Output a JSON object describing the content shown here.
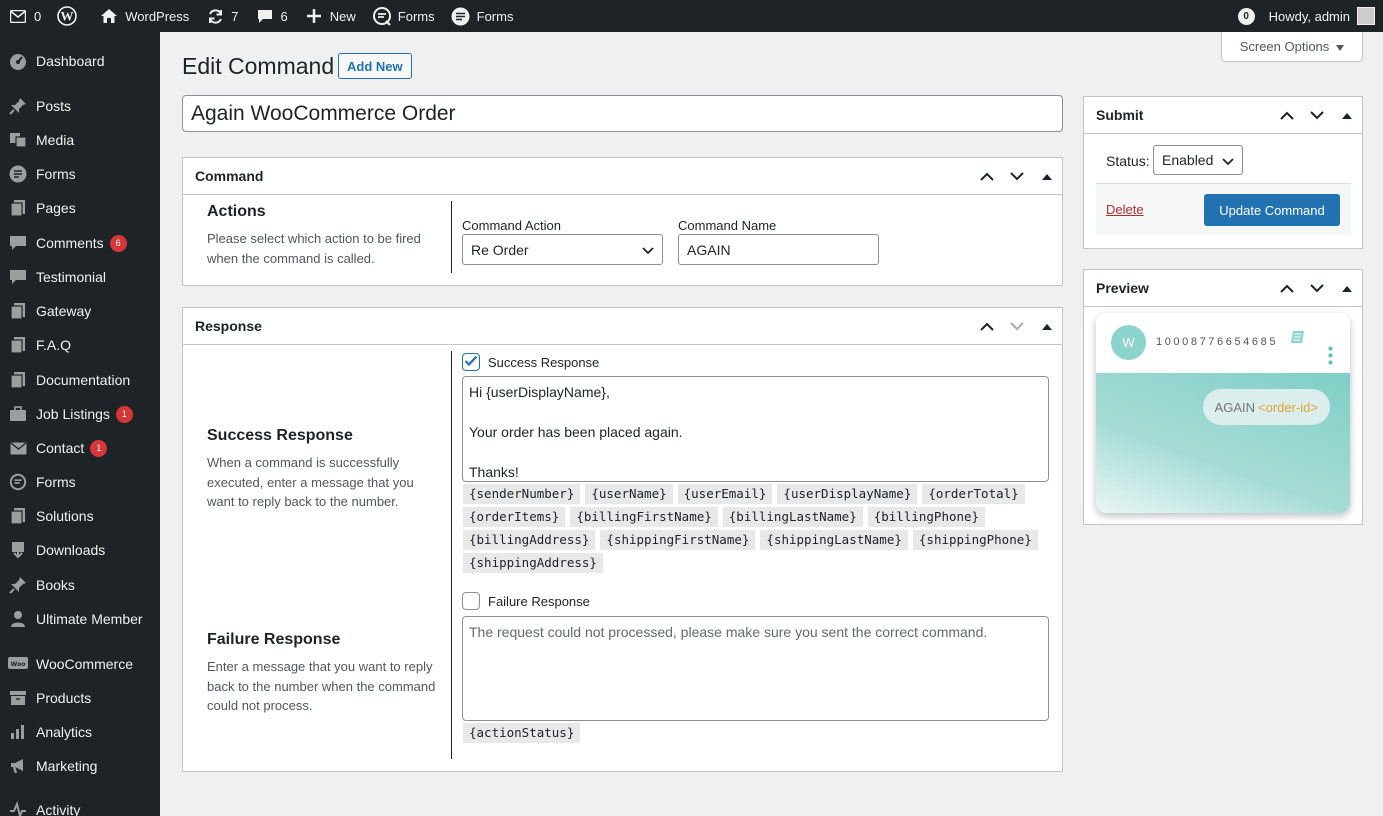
{
  "adminbar": {
    "updates_label": "0",
    "site_name": "WordPress",
    "refresh_count": "7",
    "comments_count": "6",
    "new_label": "New",
    "forms1_label": "Forms",
    "forms2_label": "Forms",
    "notifications": "0",
    "howdy": "Howdy, admin"
  },
  "sidebar": {
    "items": [
      {
        "label": "Dashboard",
        "icon": "dashboard-icon"
      },
      {
        "label": "Posts",
        "icon": "pin-icon"
      },
      {
        "label": "Media",
        "icon": "media-icon"
      },
      {
        "label": "Forms",
        "icon": "forms-icon"
      },
      {
        "label": "Pages",
        "icon": "page-icon"
      },
      {
        "label": "Comments",
        "icon": "comment-icon",
        "badge": "6"
      },
      {
        "label": "Testimonial",
        "icon": "comment-icon"
      },
      {
        "label": "Gateway",
        "icon": "page-icon"
      },
      {
        "label": "F.A.Q",
        "icon": "page-icon"
      },
      {
        "label": "Documentation",
        "icon": "page-icon"
      },
      {
        "label": "Job Listings",
        "icon": "briefcase-icon",
        "badge": "1"
      },
      {
        "label": "Contact",
        "icon": "mail-icon",
        "badge": "1"
      },
      {
        "label": "Forms",
        "icon": "forms-icon"
      },
      {
        "label": "Solutions",
        "icon": "page-icon"
      },
      {
        "label": "Downloads",
        "icon": "download-icon"
      },
      {
        "label": "Books",
        "icon": "pin-icon"
      },
      {
        "label": "Ultimate Member",
        "icon": "user-icon"
      },
      {
        "label": "WooCommerce",
        "icon": "woo-icon"
      },
      {
        "label": "Products",
        "icon": "archive-icon"
      },
      {
        "label": "Analytics",
        "icon": "chart-icon"
      },
      {
        "label": "Marketing",
        "icon": "megaphone-icon"
      },
      {
        "label": "Activity",
        "icon": "activity-icon"
      }
    ]
  },
  "screen_options": "Screen Options",
  "page": {
    "title": "Edit Command",
    "add_new": "Add New",
    "post_title": "Again WooCommerce Order"
  },
  "command_box": {
    "title": "Command",
    "actions_heading": "Actions",
    "actions_desc": "Please select which action to be fired when the command is called.",
    "action_label": "Command Action",
    "action_value": "Re Order",
    "name_label": "Command Name",
    "name_value": "AGAIN"
  },
  "response_box": {
    "title": "Response",
    "success_heading": "Success Response",
    "success_desc": "When a command is successfully executed, enter a message that you want to reply back to the number.",
    "success_checkbox_label": "Success Response",
    "success_checked": true,
    "success_message": "Hi {userDisplayName},\n\nYour order has been placed again.\n\nThanks!",
    "success_tags": [
      "{senderNumber}",
      "{userName}",
      "{userEmail}",
      "{userDisplayName}",
      "{orderTotal}",
      "{orderItems}",
      "{billingFirstName}",
      "{billingLastName}",
      "{billingPhone}",
      "{billingAddress}",
      "{shippingFirstName}",
      "{shippingLastName}",
      "{shippingPhone}",
      "{shippingAddress}"
    ],
    "failure_heading": "Failure Response",
    "failure_desc": "Enter a message that you want to reply back to the number when the command could not process.",
    "failure_checkbox_label": "Failure Response",
    "failure_checked": false,
    "failure_placeholder": "The request could not processed, please make sure you sent the correct command.",
    "failure_tags": [
      "{actionStatus}"
    ]
  },
  "submit_box": {
    "title": "Submit",
    "status_label": "Status:",
    "status_value": "Enabled",
    "delete_label": "Delete",
    "update_label": "Update Command"
  },
  "preview_box": {
    "title": "Preview",
    "avatar_letter": "W",
    "phone_number": "10008776654685",
    "message_text": "AGAIN",
    "message_var": "<order-id>"
  },
  "colors": {
    "admin_dark": "#1d2327",
    "primary": "#2271b1",
    "badge_red": "#d63638",
    "delete_red": "#b32d2e",
    "teal": "#8dd3cd",
    "order_var": "#e0a32e"
  }
}
